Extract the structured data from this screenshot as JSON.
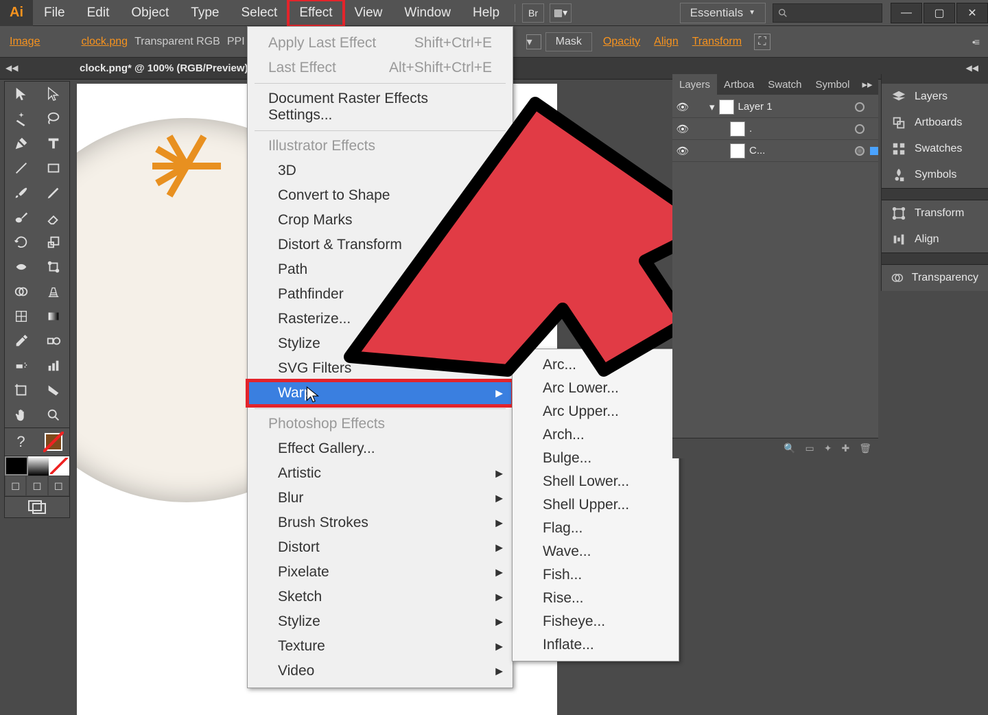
{
  "menubar": {
    "items": [
      "File",
      "Edit",
      "Object",
      "Type",
      "Select",
      "Effect",
      "View",
      "Window",
      "Help"
    ],
    "highlighted_index": 5,
    "workspace": "Essentials"
  },
  "controlbar": {
    "label": "Image",
    "filename": "clock.png",
    "colormode": "Transparent RGB",
    "ppi": "PPI",
    "mask": "Mask",
    "links": [
      "Opacity",
      "Align",
      "Transform"
    ]
  },
  "document_tab": "clock.png* @ 100% (RGB/Preview)",
  "effect_menu": {
    "apply_last": {
      "label": "Apply Last Effect",
      "shortcut": "Shift+Ctrl+E"
    },
    "last": {
      "label": "Last Effect",
      "shortcut": "Alt+Shift+Ctrl+E"
    },
    "raster_settings": "Document Raster Effects Settings...",
    "section1": "Illustrator Effects",
    "items1": [
      "3D",
      "Convert to Shape",
      "Crop Marks",
      "Distort & Transform",
      "Path",
      "Pathfinder",
      "Rasterize...",
      "Stylize",
      "SVG Filters",
      "Warp"
    ],
    "highlighted_item": "Warp",
    "section2": "Photoshop Effects",
    "items2": [
      "Effect Gallery...",
      "Artistic",
      "Blur",
      "Brush Strokes",
      "Distort",
      "Pixelate",
      "Sketch",
      "Stylize",
      "Texture",
      "Video"
    ]
  },
  "warp_submenu": [
    "Arc...",
    "Arc Lower...",
    "Arc Upper...",
    "Arch...",
    "Bulge...",
    "Shell Lower...",
    "Shell Upper...",
    "Flag...",
    "Wave...",
    "Fish...",
    "Rise...",
    "Fisheye...",
    "Inflate..."
  ],
  "layers_panel": {
    "tabs": [
      "Layers",
      "Artboa",
      "Swatch",
      "Symbol"
    ],
    "rows": [
      {
        "name": "Layer 1",
        "expandable": true,
        "selected": false
      },
      {
        "name": ".",
        "expandable": false,
        "selected": false
      },
      {
        "name": "C...",
        "expandable": false,
        "selected": true
      }
    ]
  },
  "right_panels": [
    "Layers",
    "Artboards",
    "Swatches",
    "Symbols",
    "Transform",
    "Align",
    "Transparency"
  ]
}
